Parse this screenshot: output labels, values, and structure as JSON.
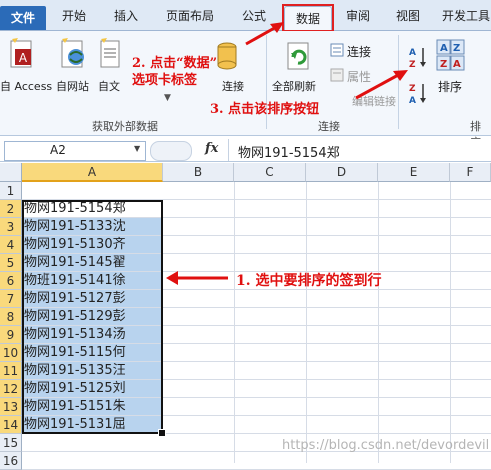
{
  "ribbon": {
    "tabs": [
      {
        "label": "文件"
      },
      {
        "label": "开始"
      },
      {
        "label": "插入"
      },
      {
        "label": "页面布局"
      },
      {
        "label": "公式"
      },
      {
        "label": "数据"
      },
      {
        "label": "审阅"
      },
      {
        "label": "视图"
      },
      {
        "label": "开发工具"
      }
    ],
    "buttons": {
      "access": "自 Access",
      "web": "自网站",
      "text": "自文",
      "other": "连接",
      "refresh_all": "全部刷新",
      "connections": "连接",
      "properties": "属性",
      "edit_links": "编辑链接",
      "sort": "排序",
      "az": "A Z",
      "za": "Z A"
    },
    "groups": {
      "external": "获取外部数据",
      "connections": "连接",
      "sort": "排序"
    }
  },
  "formula_bar": {
    "name_box": "A2",
    "fx": "fx",
    "content": "物网191-5154郑"
  },
  "sheet": {
    "columns": [
      "A",
      "B",
      "C",
      "D",
      "E",
      "F"
    ],
    "rows": [
      "1",
      "2",
      "3",
      "4",
      "5",
      "6",
      "7",
      "8",
      "9",
      "10",
      "11",
      "12",
      "13",
      "14",
      "15",
      "16"
    ],
    "cells": [
      "物网191-5154郑",
      "物网191-5133沈",
      "物网191-5130齐",
      "物网191-5145翟",
      "物班191-5141徐",
      "物网191-5127彭",
      "物网191-5129彭",
      "物网191-5134汤",
      "物网191-5115何",
      "物网191-5135汪",
      "物网191-5125刘",
      "物网191-5151朱",
      "物网191-5131屈"
    ]
  },
  "annotations": {
    "step1": "1. 选中要排序的签到行",
    "step2_line1": "2. 点击“数据”",
    "step2_line2": "选项卡标签",
    "step3": "3. 点击该排序按钮"
  },
  "watermark": "https://blog.csdn.net/devordevil",
  "colors": {
    "file_tab": "#2b6bb8",
    "selection_fill": "#b8d3ee",
    "header_highlight": "#f9d97c",
    "annotation": "#e01010"
  }
}
